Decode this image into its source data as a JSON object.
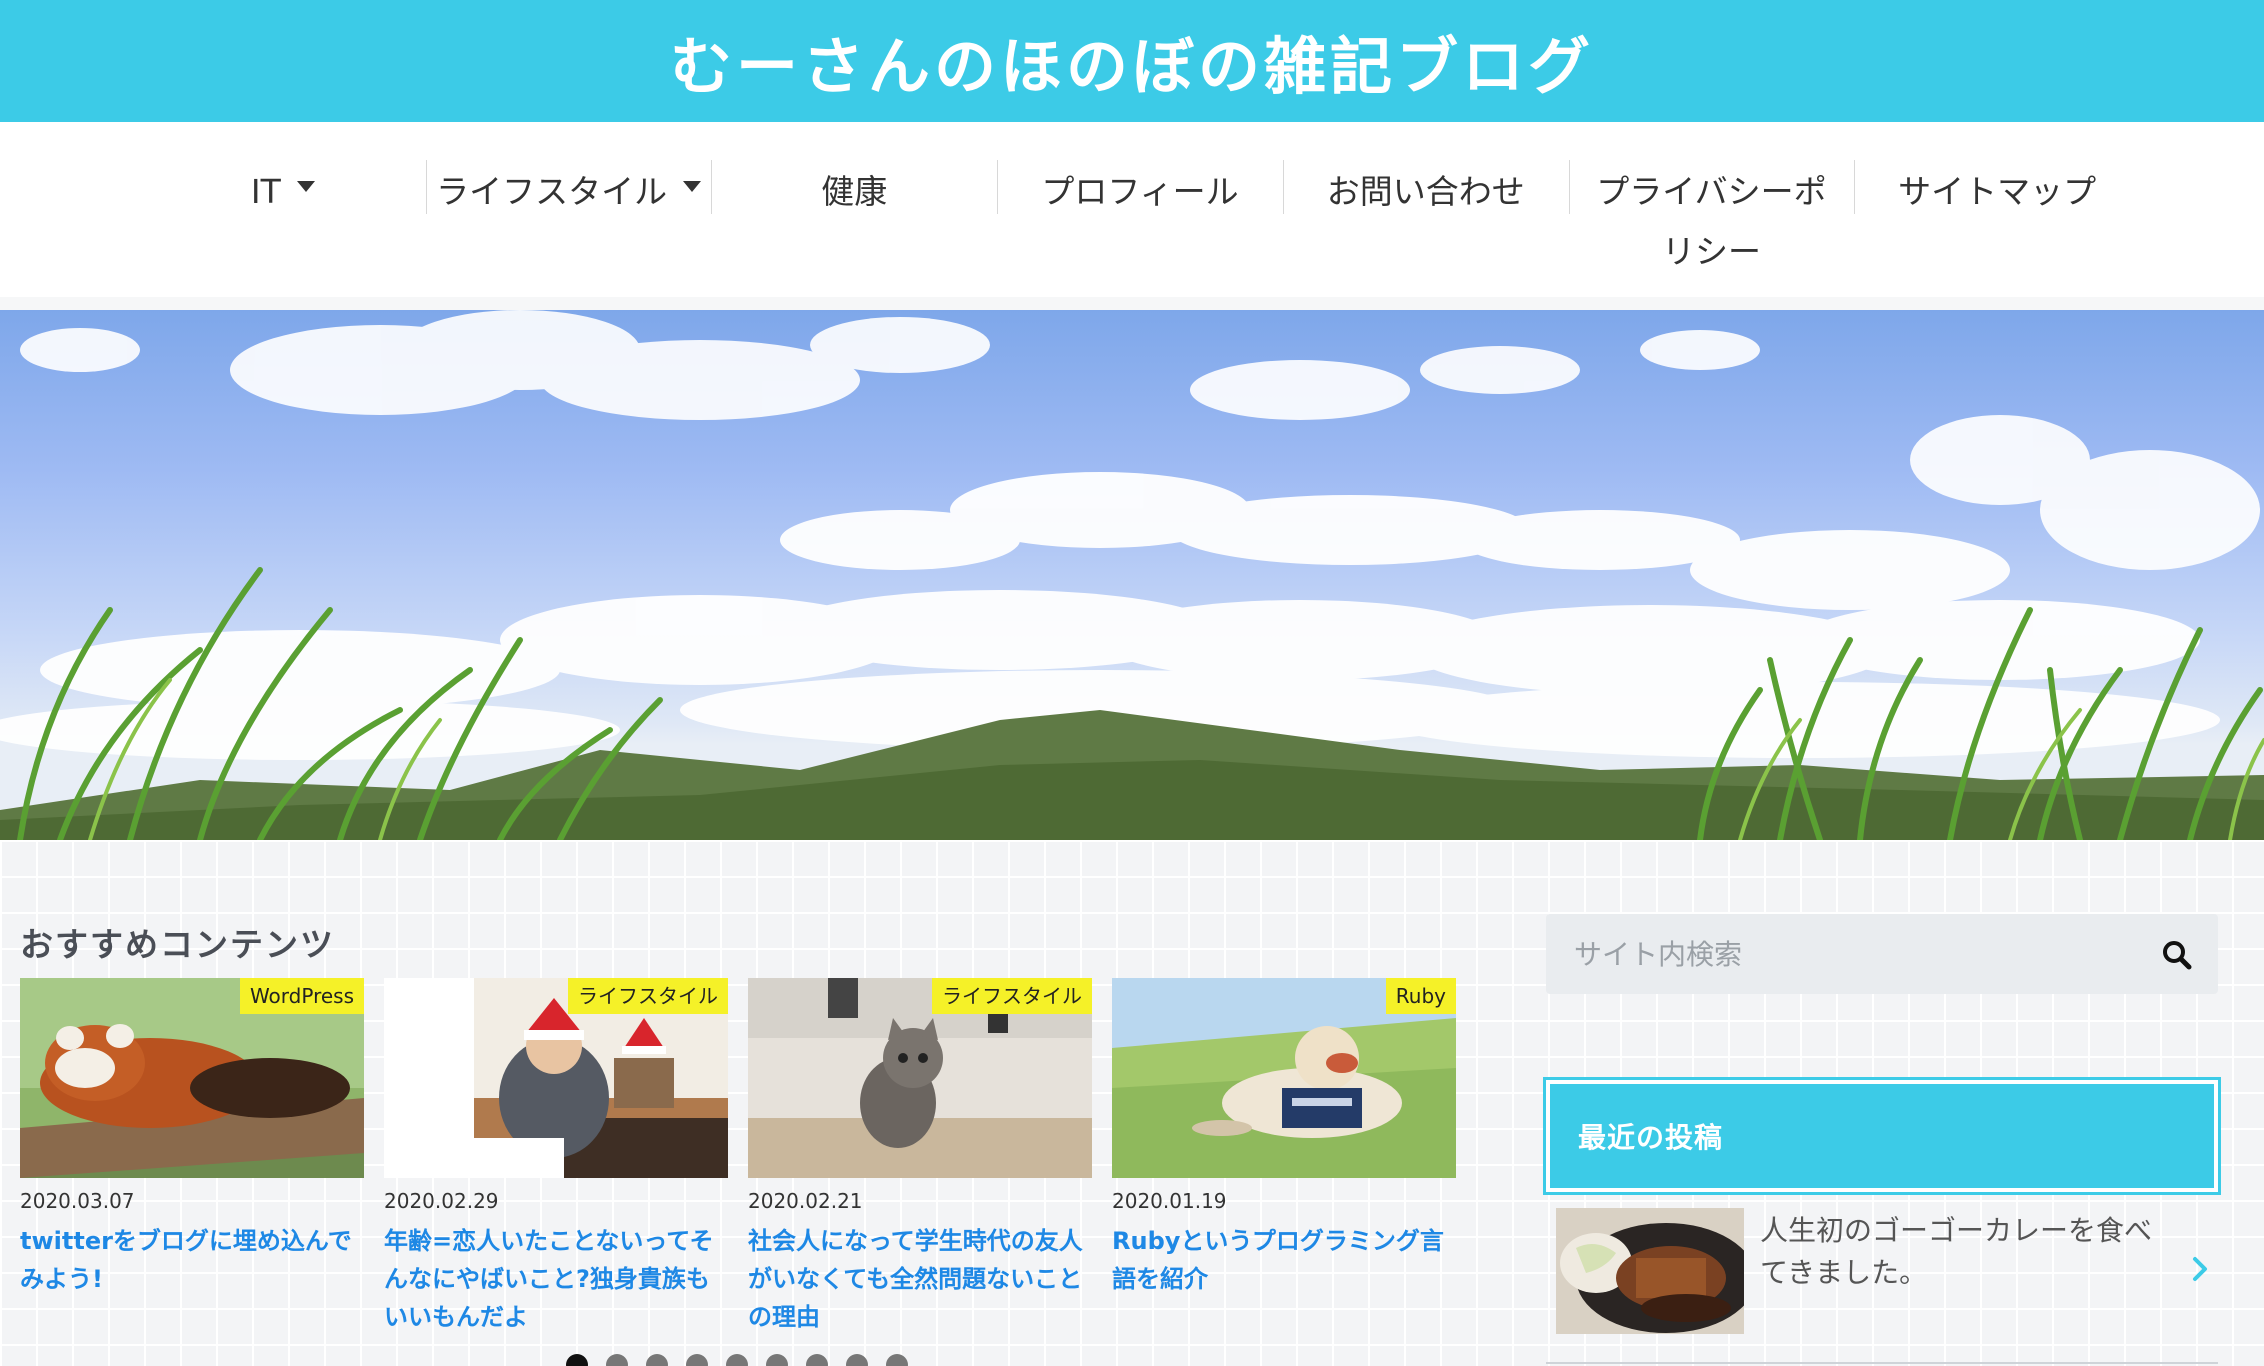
{
  "site": {
    "title": "むーさんのほのぼの雑記ブログ",
    "accent_color": "#3ccbe7"
  },
  "nav": {
    "items": [
      {
        "label": "IT",
        "has_dropdown": true
      },
      {
        "label": "ライフスタイル",
        "has_dropdown": true
      },
      {
        "label": "健康",
        "has_dropdown": false
      },
      {
        "label": "プロフィール",
        "has_dropdown": false
      },
      {
        "label": "お問い合わせ",
        "has_dropdown": false
      },
      {
        "label": "プライバシーポリシー",
        "has_dropdown": false
      },
      {
        "label": "サイトマップ",
        "has_dropdown": false
      }
    ]
  },
  "recommended": {
    "heading": "おすすめコンテンツ",
    "cards": [
      {
        "category": "WordPress",
        "date": "2020.03.07",
        "title": "twitterをブログに埋め込んでみよう!",
        "thumb": "red-panda-photo"
      },
      {
        "category": "ライフスタイル",
        "date": "2020.02.29",
        "title": "年齢=恋人いたことないってそんなにやばいこと?独身貴族もいいもんだよ",
        "thumb": "santa-hat-man-photo"
      },
      {
        "category": "ライフスタイル",
        "date": "2020.02.21",
        "title": "社会人になって学生時代の友人がいなくても全然問題ないことの理由",
        "thumb": "kitten-photo"
      },
      {
        "category": "Ruby",
        "date": "2020.01.19",
        "title": "Rubyというプログラミング言語を紹介",
        "thumb": "dog-on-grass-photo"
      }
    ],
    "carousel": {
      "total_dots": 9,
      "active_index": 0
    }
  },
  "sidebar": {
    "search": {
      "placeholder": "サイト内検索",
      "icon": "search-icon"
    },
    "recent": {
      "heading": "最近の投稿",
      "items": [
        {
          "title": "人生初のゴーゴーカレーを食べてきました。",
          "thumb": "curry-photo"
        }
      ]
    }
  }
}
